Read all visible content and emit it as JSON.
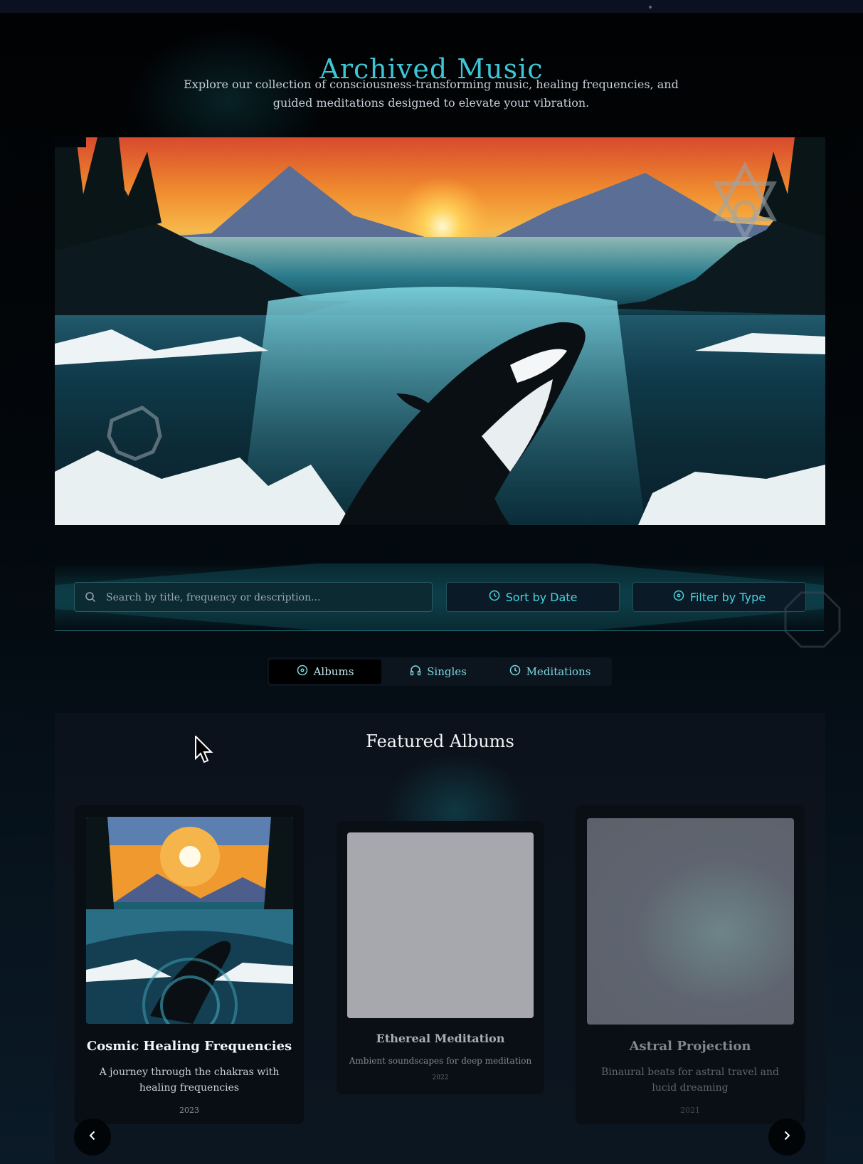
{
  "page": {
    "title": "Archived Music",
    "subtitle": "Explore our collection of consciousness-transforming music, healing frequencies, and guided meditations designed to elevate your vibration."
  },
  "hero": {
    "image": "orca-breaching-at-sunset-artwork"
  },
  "toolbar": {
    "search_placeholder": "Search by title, frequency or description...",
    "sort_label": "Sort by Date",
    "filter_label": "Filter by Type"
  },
  "tabs": [
    {
      "label": "Albums",
      "icon": "disc-icon",
      "active": true
    },
    {
      "label": "Singles",
      "icon": "headphones-icon",
      "active": false
    },
    {
      "label": "Meditations",
      "icon": "clock-icon",
      "active": false
    }
  ],
  "featured": {
    "title": "Featured Albums",
    "albums": [
      {
        "title": "Cosmic Healing Frequencies",
        "description": "A journey through the chakras with healing frequencies",
        "year": "2023"
      },
      {
        "title": "Ethereal Meditation",
        "description": "Ambient soundscapes for deep meditation",
        "year": "2022"
      },
      {
        "title": "Astral Projection",
        "description": "Binaural beats for astral travel and lucid dreaming",
        "year": "2021"
      }
    ]
  },
  "icons": {
    "search": "search-icon",
    "sort": "clock-icon",
    "filter": "disc-icon",
    "prev": "chevron-left-icon",
    "next": "chevron-right-icon"
  },
  "colors": {
    "accent": "#3fc6d6",
    "button_text": "#45d6e0",
    "background": "#02070b"
  }
}
